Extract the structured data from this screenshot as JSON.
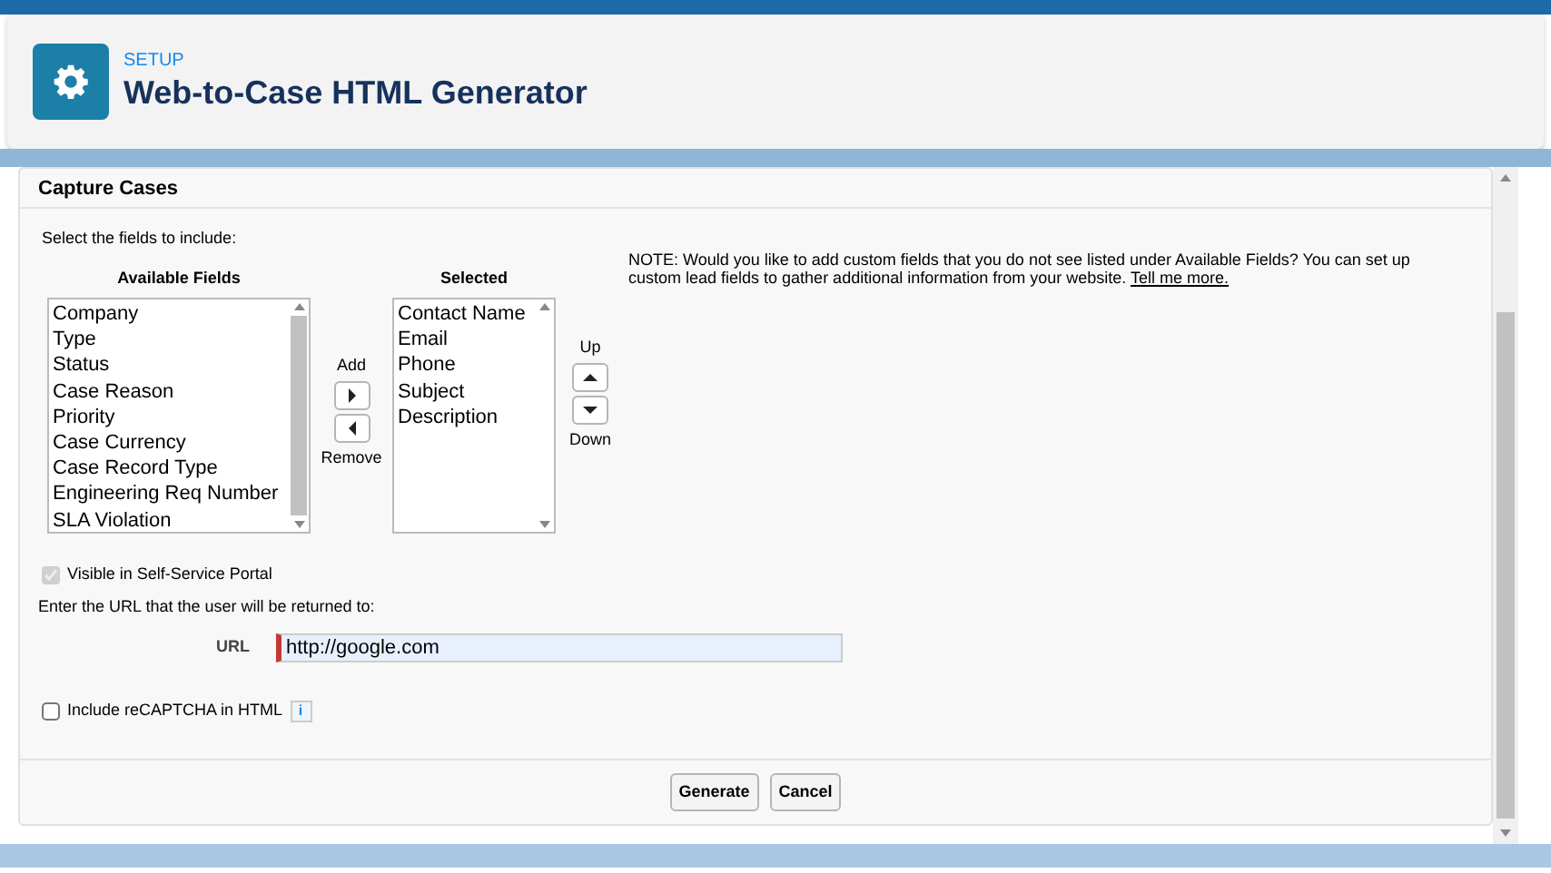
{
  "header": {
    "breadcrumb": "SETUP",
    "title": "Web-to-Case HTML Generator"
  },
  "panel": {
    "title": "Capture Cases",
    "instruction": "Select the fields to include:",
    "available": {
      "label": "Available Fields",
      "items": [
        "Company",
        "Type",
        "Status",
        "Case Reason",
        "Priority",
        "Case Currency",
        "Case Record Type",
        "Engineering Req Number",
        "SLA Violation"
      ]
    },
    "move_buttons": {
      "add_label": "Add",
      "remove_label": "Remove"
    },
    "selected": {
      "label": "Selected",
      "items": [
        "Contact Name",
        "Email",
        "Phone",
        "Subject",
        "Description"
      ]
    },
    "order_buttons": {
      "up_label": "Up",
      "down_label": "Down"
    },
    "note": {
      "text": "NOTE: Would you like to add custom fields that you do not see listed under Available Fields? You can set up custom lead fields to gather additional information from your website.",
      "link": "Tell me more."
    },
    "portal_checkbox": {
      "label": "Visible in Self-Service Portal",
      "checked": true,
      "disabled": true
    },
    "url_prompt": "Enter the URL that the user will be returned to:",
    "url_field": {
      "label": "URL",
      "value": "http://google.com"
    },
    "recaptcha_checkbox": {
      "label": "Include reCAPTCHA in HTML",
      "checked": false,
      "disabled": false,
      "info_glyph": "i"
    },
    "buttons": [
      "Generate",
      "Cancel"
    ]
  }
}
